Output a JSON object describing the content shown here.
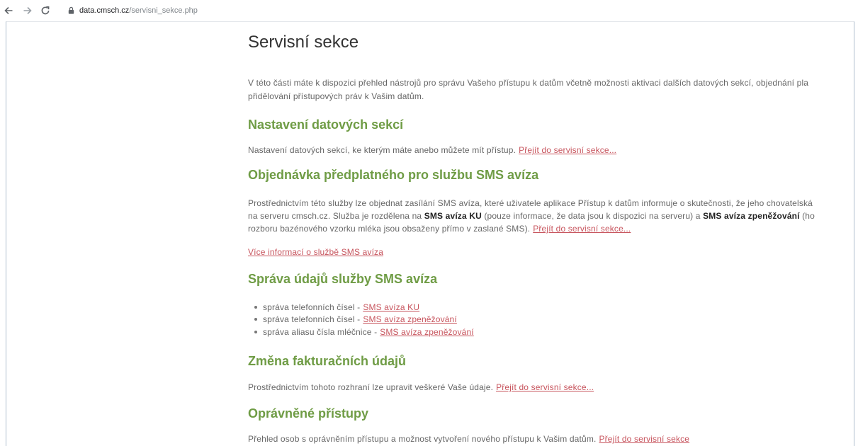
{
  "browser": {
    "url_host": "data.cmsch.cz",
    "url_path": "/servisni_sekce.php",
    "icons": [
      "back-arrow-icon",
      "forward-arrow-icon",
      "reload-icon",
      "lock-icon"
    ]
  },
  "colors": {
    "title": "#333333",
    "section_heading": "#6f9c45",
    "text": "#666666",
    "link": "#c7545d",
    "bold_text": "#222222"
  },
  "page": {
    "title": "Servisní sekce",
    "intro_lines": [
      "V této části máte k dispozici přehled nástrojů pro správu Vašeho přístupu k datům včetně možnosti aktivaci dalších datových sekcí, objednání pla",
      "přidělování přístupových práv k Vašim datům."
    ],
    "data_sections": {
      "heading": "Nastavení datových sekcí",
      "text": "Nastavení datových sekcí, ke kterým máte anebo můžete mít přístup.",
      "link": "Přejít do servisní sekce..."
    },
    "sms_order": {
      "heading": "Objednávka předplatného pro službu SMS avíza",
      "line1": "Prostřednictvím této služby lze objednat zasílání SMS avíza, které uživatele aplikace Přístup k datům informuje o skutečnosti, že jeho chovatelská",
      "line2_segments": [
        "na serveru cmsch.cz. Služba je rozdělena na ",
        "SMS avíza KU",
        " (pouze informace, že data jsou k dispozici na serveru) a ",
        "SMS avíza zpeněžování",
        " (ho"
      ],
      "line3": "rozboru bazénového vzorku mléka jsou obsaženy přímo v zaslané SMS).",
      "link": "Přejít do servisní sekce...",
      "more_info_link": "Více informací o službě SMS avíza"
    },
    "sms_management": {
      "heading": "Správa údajů služby SMS avíza",
      "items": [
        {
          "text": "správa telefonních čísel -",
          "link": "SMS avíza KU"
        },
        {
          "text": "správa telefonních čísel -",
          "link": "SMS avíza zpeněžování"
        },
        {
          "text": "správa aliasu čísla mléčnice -",
          "link": "SMS avíza zpeněžování"
        }
      ]
    },
    "billing": {
      "heading": "Změna fakturačních údajů",
      "text": "Prostřednictvím tohoto rozhraní lze upravit veškeré Vaše údaje.",
      "link": "Přejít do servisní sekce..."
    },
    "access": {
      "heading": "Oprávněné přístupy",
      "text": "Přehled osob s oprávněním přístupu a možnost vytvoření nového přístupu k Vašim datům.",
      "link": "Přejít do servisní sekce"
    }
  }
}
